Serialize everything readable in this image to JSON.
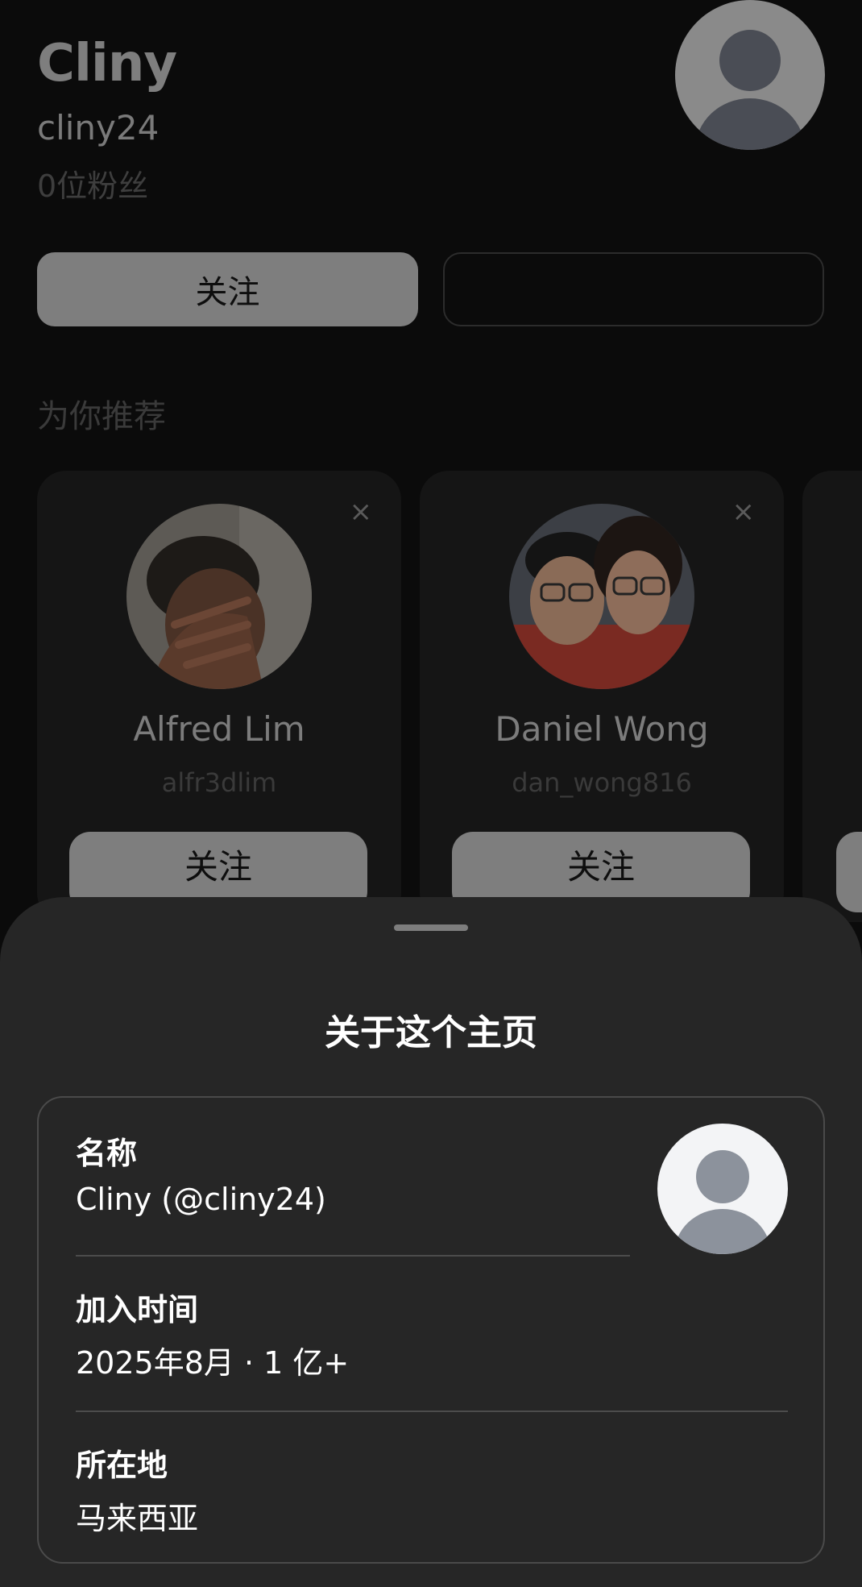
{
  "profile": {
    "display_name": "Cliny",
    "username": "cliny24",
    "followers": "0位粉丝",
    "follow_button": "关注",
    "secondary_button": ""
  },
  "recommendations": {
    "heading": "为你推荐",
    "close_symbol": "×",
    "cards": [
      {
        "name": "Alfred Lim",
        "username": "alfr3dlim",
        "button": "关注"
      },
      {
        "name": "Daniel Wong",
        "username": "dan_wong816",
        "button": "关注"
      }
    ]
  },
  "about_sheet": {
    "title": "关于这个主页",
    "name_label": "名称",
    "name_value": "Cliny (@cliny24)",
    "joined_label": "加入时间",
    "joined_value": "2025年8月 · 1 亿+",
    "location_label": "所在地",
    "location_value": "马来西亚"
  },
  "colors": {
    "background": "#0b0b0b",
    "sheet": "#262626",
    "button_dimmed": "#7e7e7e"
  },
  "icons": [
    "avatar-placeholder-icon",
    "close-icon"
  ]
}
